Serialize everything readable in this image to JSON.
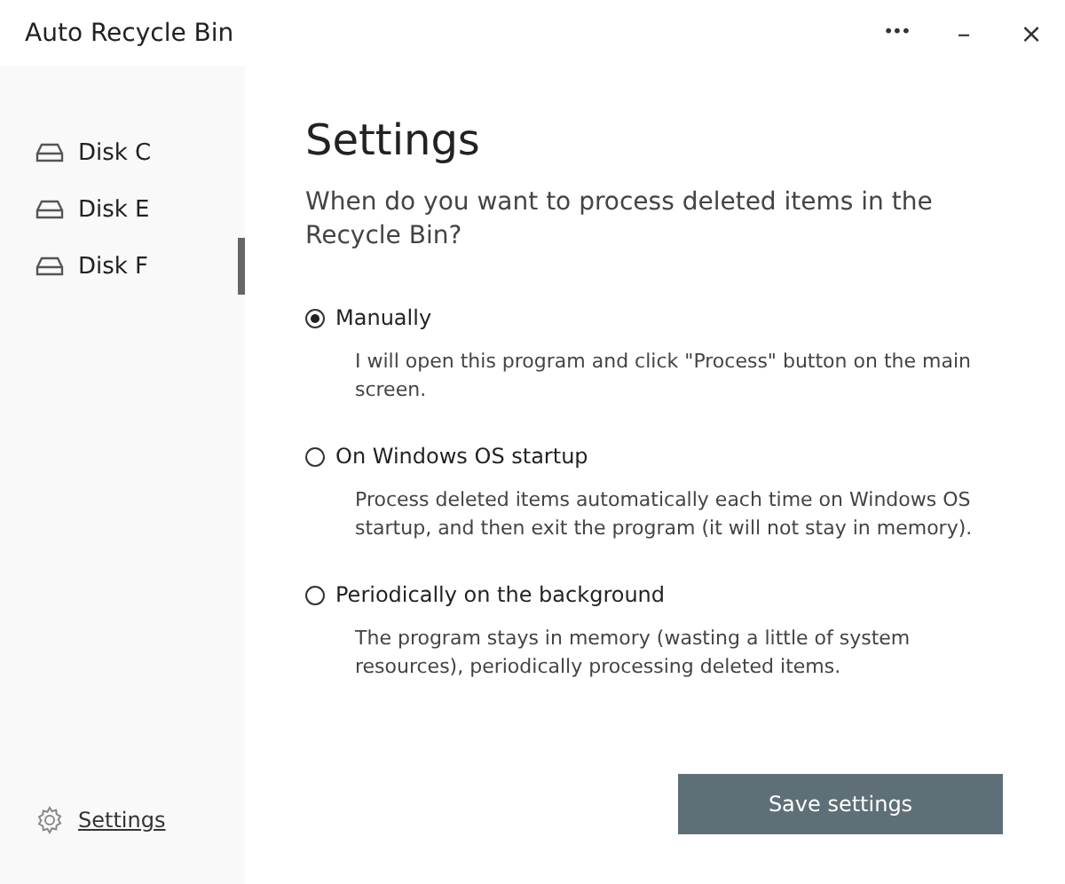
{
  "window": {
    "title": "Auto Recycle Bin",
    "controls": [
      "•••",
      "–",
      "×"
    ]
  },
  "sidebar": {
    "items": [
      {
        "label": "Disk C",
        "selected": false
      },
      {
        "label": "Disk E",
        "selected": false
      },
      {
        "label": "Disk F",
        "selected": true
      }
    ],
    "footer_link": "Settings"
  },
  "content": {
    "title": "Settings",
    "question": "When do you want to process deleted items in the Recycle Bin?",
    "options": [
      {
        "label": "Manually",
        "selected": true,
        "description": "I will open this program and click \"Process\" button on the main screen."
      },
      {
        "label": "On Windows OS startup",
        "selected": false,
        "description": "Process deleted items automatically each time on Windows OS startup, and then exit the program (it will not stay in memory)."
      },
      {
        "label": "Periodically on the background",
        "selected": false,
        "description": "The program stays in memory (wasting a little of system resources), periodically processing deleted items."
      }
    ],
    "save_button": "Save settings"
  }
}
